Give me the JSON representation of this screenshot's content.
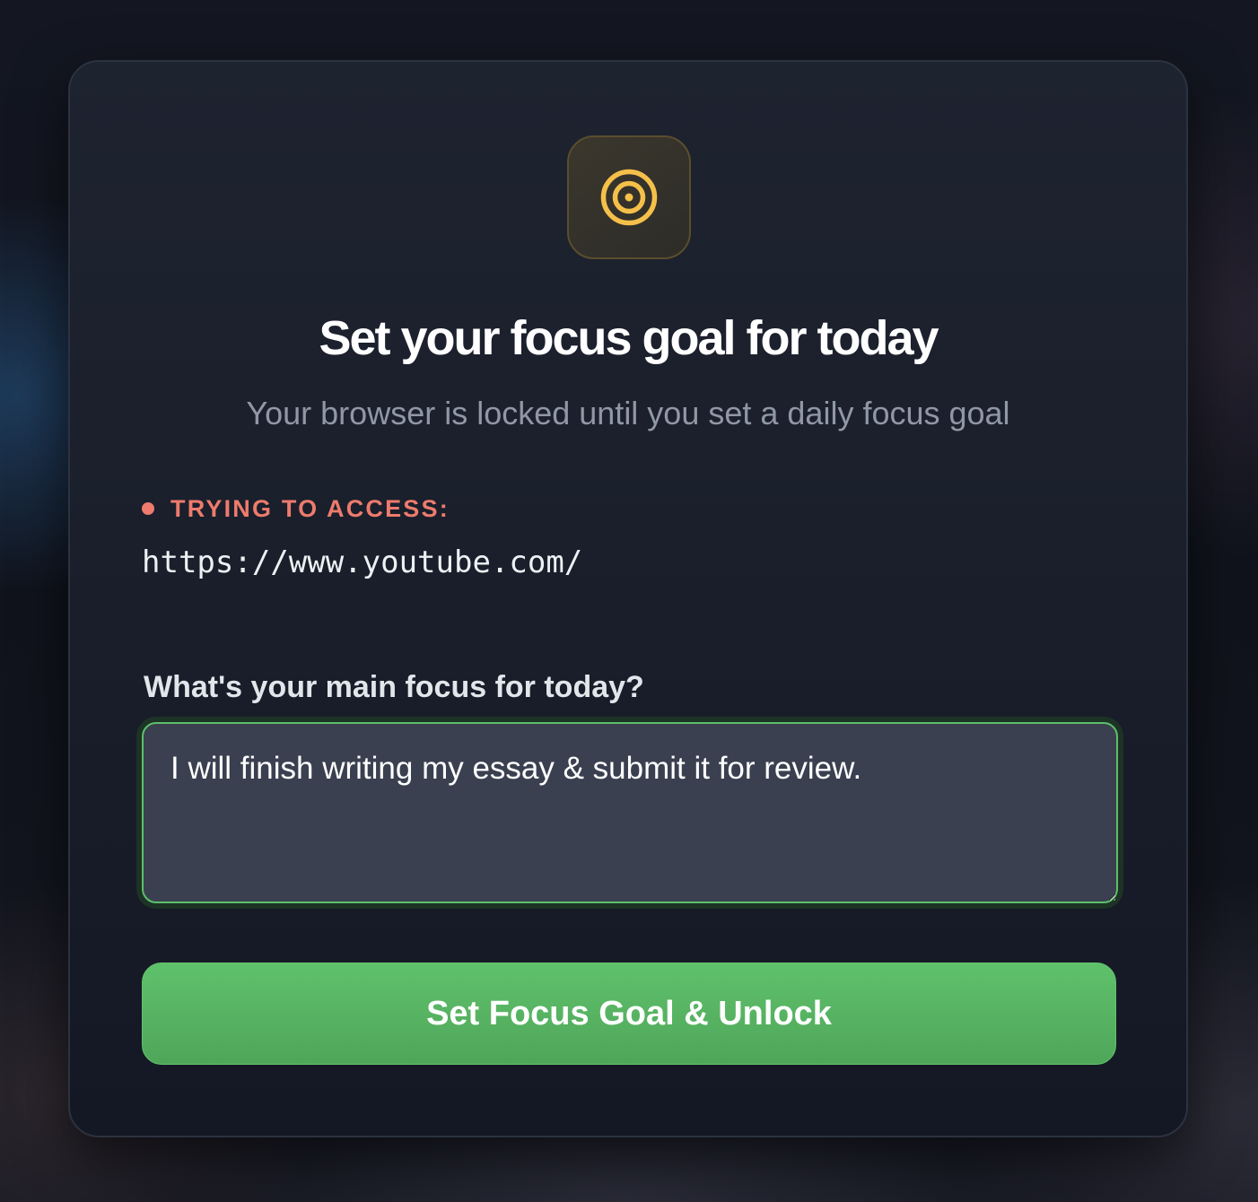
{
  "header": {
    "icon": "target-icon",
    "title": "Set your focus goal for today",
    "subtitle": "Your browser is locked until you set a daily focus goal"
  },
  "access": {
    "label": "TRYING TO ACCESS:",
    "url": "https://www.youtube.com/"
  },
  "goal": {
    "label": "What's your main focus for today?",
    "value": "I will finish writing my essay & submit it for review."
  },
  "submit": {
    "label": "Set Focus Goal & Unlock"
  },
  "colors": {
    "accent_green": "#5cbf6a",
    "warning_red": "#ee7b6d",
    "icon_gold": "#f5c04a"
  }
}
